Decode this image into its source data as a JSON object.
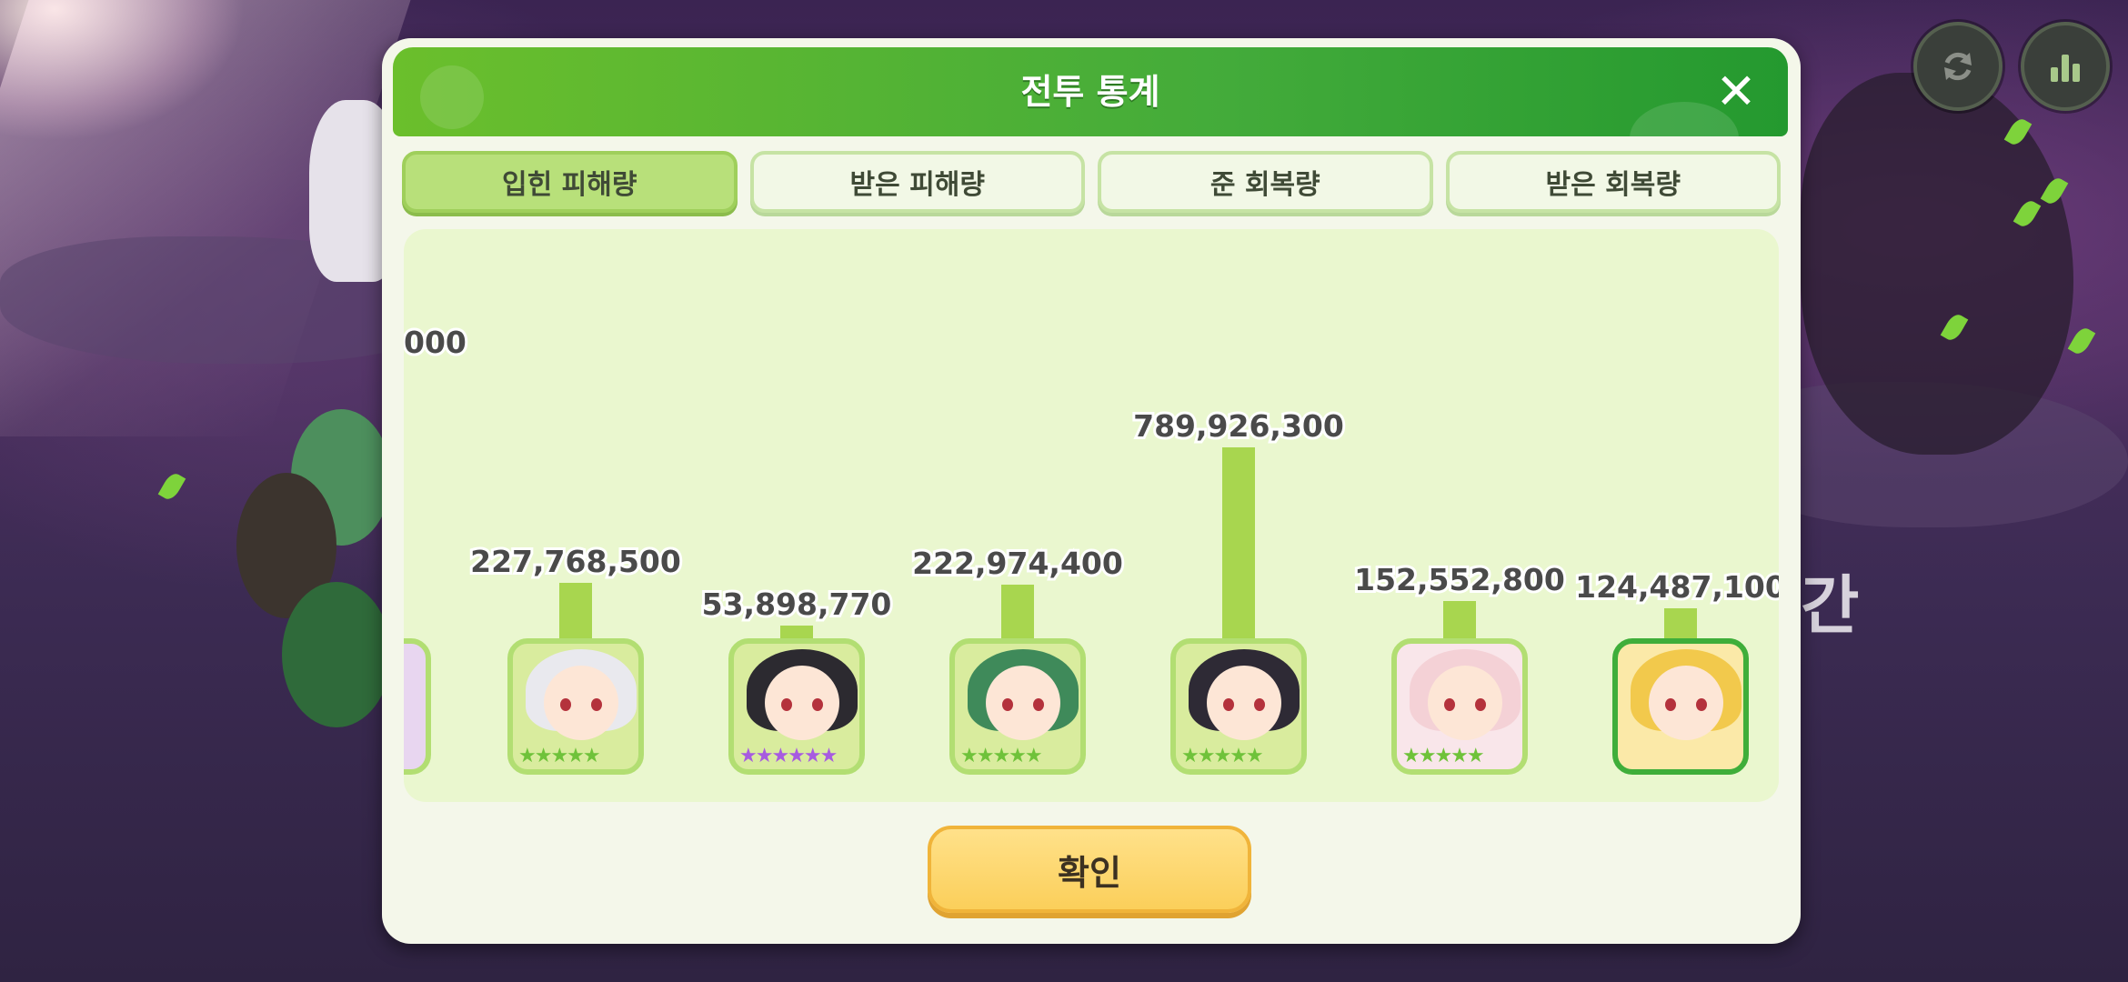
{
  "dialog": {
    "title": "전투 통계",
    "close_label": "✕",
    "confirm_label": "확인"
  },
  "tabs": [
    {
      "label": "입힌 피해량",
      "active": true
    },
    {
      "label": "받은 피해량",
      "active": false
    },
    {
      "label": "준 회복량",
      "active": false
    },
    {
      "label": "받은 회복량",
      "active": false
    }
  ],
  "top_buttons": [
    {
      "icon": "refresh-icon"
    },
    {
      "icon": "bar-chart-icon"
    }
  ],
  "background_text": "간",
  "chart_data": {
    "type": "bar",
    "partial_left_label": "000",
    "entries": [
      {
        "value": 227768500,
        "label": "227,768,500",
        "stars": 5,
        "star_color": "#6fc23a",
        "hair": "#e9e9ee",
        "bg": "#d9ec9e"
      },
      {
        "value": 53898770,
        "label": "53,898,770",
        "stars": 6,
        "star_color": "#a75be0",
        "hair": "#2c2a30",
        "bg": "#d9ec9e"
      },
      {
        "value": 222974400,
        "label": "222,974,400",
        "stars": 5,
        "star_color": "#6fc23a",
        "hair": "#3f8a5a",
        "bg": "#d9ec9e"
      },
      {
        "value": 789926300,
        "label": "789,926,300",
        "stars": 5,
        "star_color": "#6fc23a",
        "hair": "#2e2a35",
        "bg": "#d9ec9e"
      },
      {
        "value": 152552800,
        "label": "152,552,800",
        "stars": 5,
        "star_color": "#6fc23a",
        "hair": "#f4d1d6",
        "bg": "#f9e6ea"
      },
      {
        "value": 124487100,
        "label": "124,487,100",
        "stars": 0,
        "star_color": "#6fc23a",
        "hair": "#f2c94c",
        "bg": "#fbe9a8"
      }
    ]
  }
}
